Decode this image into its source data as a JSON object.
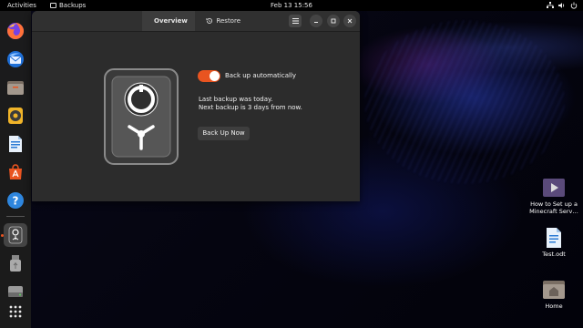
{
  "topbar": {
    "activities": "Activities",
    "app_name": "Backups",
    "clock": "Feb 13  15:56"
  },
  "dock": {
    "items": [
      {
        "name": "firefox",
        "icon": "firefox-icon"
      },
      {
        "name": "thunderbird",
        "icon": "thunderbird-icon"
      },
      {
        "name": "files",
        "icon": "files-icon"
      },
      {
        "name": "rhythmbox",
        "icon": "rhythmbox-icon"
      },
      {
        "name": "writer",
        "icon": "libreoffice-writer-icon"
      },
      {
        "name": "software",
        "icon": "software-center-icon"
      },
      {
        "name": "help",
        "icon": "help-icon"
      },
      {
        "name": "backups",
        "icon": "backups-vault-icon",
        "active": true
      },
      {
        "name": "usb-drive",
        "icon": "usb-drive-icon"
      },
      {
        "name": "disk",
        "icon": "disk-icon"
      },
      {
        "name": "show-apps",
        "icon": "app-grid-icon"
      }
    ],
    "accent": "#e95420"
  },
  "desktop": {
    "icons": [
      {
        "label": "How to Set up a Minecraft Serv…",
        "icon": "video-file-icon"
      },
      {
        "label": "Test.odt",
        "icon": "document-file-icon"
      },
      {
        "label": "Home",
        "icon": "home-folder-icon"
      }
    ]
  },
  "window": {
    "tabs": [
      {
        "label": "Overview",
        "icon": "overview-icon",
        "selected": true
      },
      {
        "label": "Restore",
        "icon": "restore-icon",
        "selected": false
      }
    ],
    "auto_backup": {
      "label": "Back up automatically",
      "enabled": true
    },
    "status_line_1": "Last backup was today.",
    "status_line_2": "Next backup is 3 days from now.",
    "backup_button": "Back Up Now",
    "accent": "#e95420"
  }
}
